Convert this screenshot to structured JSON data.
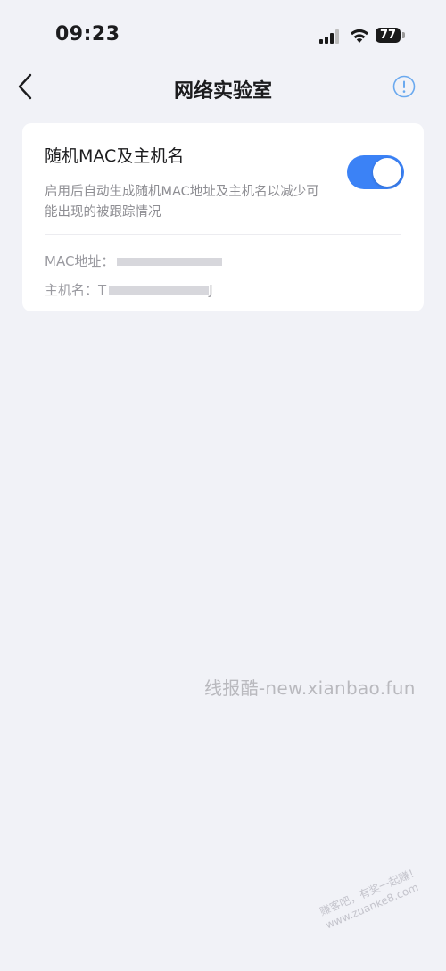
{
  "status_bar": {
    "time": "09:23",
    "battery": "77"
  },
  "nav": {
    "title": "网络实验室"
  },
  "setting": {
    "title": "随机MAC及主机名",
    "description": "启用后自动生成随机MAC地址及主机名以减少可能出现的被跟踪情况",
    "enabled": true
  },
  "info": {
    "mac_label": "MAC地址：",
    "host_label": "主机名：",
    "host_value_prefix": "T",
    "host_value_suffix": "J"
  },
  "watermarks": {
    "center": "线报酷-new.xianbao.fun",
    "corner_line1": "赚客吧，有奖一起赚！",
    "corner_line2": "www.zuanke8.com"
  },
  "colors": {
    "accent": "#3b82f6",
    "background": "#f1f2f7",
    "card": "#ffffff"
  }
}
